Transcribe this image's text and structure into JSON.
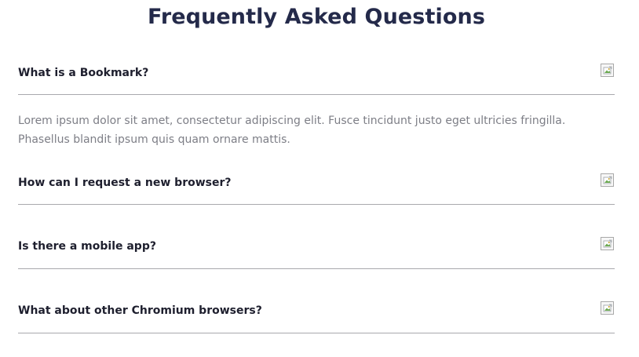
{
  "page": {
    "title": "Frequently Asked Questions"
  },
  "faq": {
    "items": [
      {
        "question": "What is a Bookmark?",
        "answer": "Lorem ipsum dolor sit amet, consectetur adipiscing elit. Fusce tincidunt justo eget ultricies fringilla. Phasellus blandit ipsum quis quam ornare mattis.",
        "expanded": true,
        "icon": "broken-image-icon"
      },
      {
        "question": "How can I request a new browser?",
        "expanded": false,
        "icon": "broken-image-icon"
      },
      {
        "question": "Is there a mobile app?",
        "expanded": false,
        "icon": "broken-image-icon"
      },
      {
        "question": "What about other Chromium browsers?",
        "expanded": false,
        "icon": "broken-image-icon"
      }
    ]
  }
}
